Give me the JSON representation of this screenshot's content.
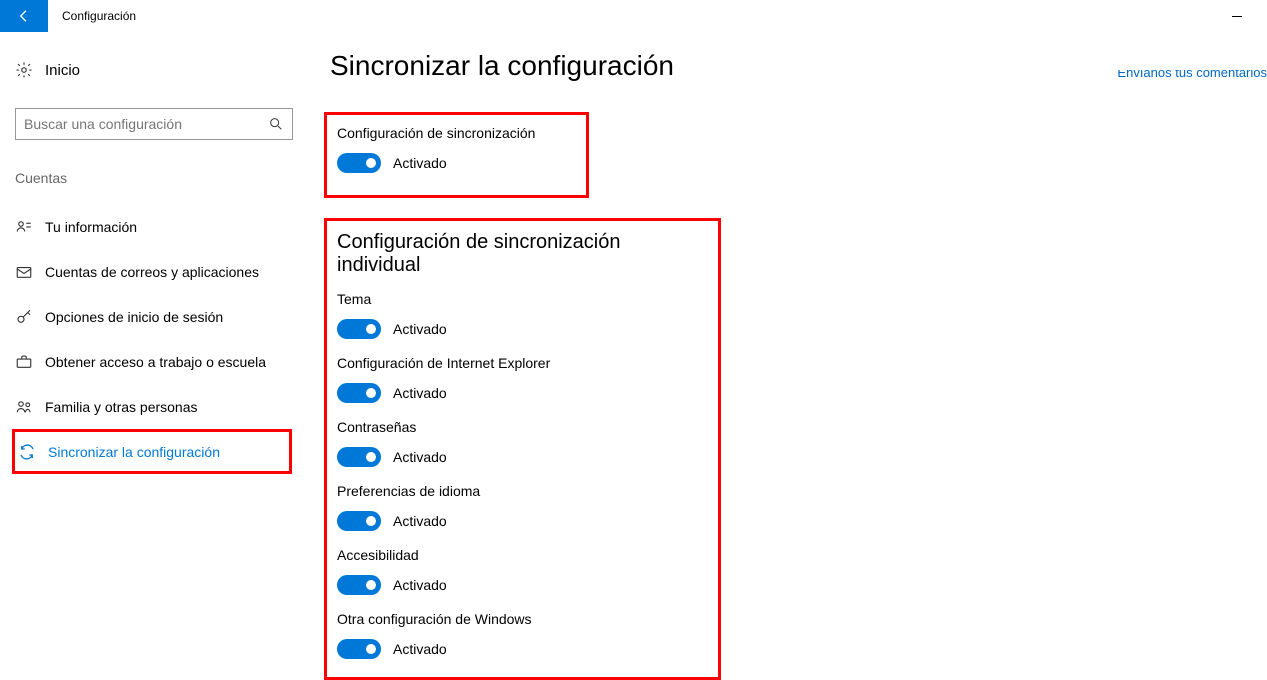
{
  "titlebar": {
    "app_title": "Configuración"
  },
  "sidebar": {
    "home_label": "Inicio",
    "search_placeholder": "Buscar una configuración",
    "section_label": "Cuentas",
    "items": [
      {
        "label": "Tu información"
      },
      {
        "label": "Cuentas de correos y aplicaciones"
      },
      {
        "label": "Opciones de inicio de sesión"
      },
      {
        "label": "Obtener acceso a trabajo o escuela"
      },
      {
        "label": "Familia y otras personas"
      },
      {
        "label": "Sincronizar la configuración"
      }
    ]
  },
  "content": {
    "page_title": "Sincronizar la configuración",
    "sync_settings_label": "Configuración de sincronización",
    "on_label": "Activado",
    "individual_title": "Configuración de sincronización individual",
    "toggles": [
      {
        "label": "Tema",
        "state": "Activado"
      },
      {
        "label": "Configuración de Internet Explorer",
        "state": "Activado"
      },
      {
        "label": "Contraseñas",
        "state": "Activado"
      },
      {
        "label": "Preferencias de idioma",
        "state": "Activado"
      },
      {
        "label": "Accesibilidad",
        "state": "Activado"
      },
      {
        "label": "Otra configuración de Windows",
        "state": "Activado"
      }
    ],
    "feedback": "Envíanos tus comentarios"
  }
}
